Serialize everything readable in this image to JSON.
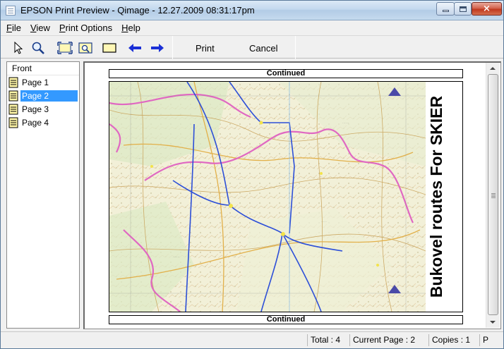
{
  "window": {
    "title": "EPSON Print Preview - Qimage - 12.27.2009 08:31:17pm",
    "minimize_label": "",
    "close_symbol": "×"
  },
  "menu": {
    "items": [
      {
        "label": "File",
        "accel": "F",
        "rest": "ile"
      },
      {
        "label": "View",
        "accel": "V",
        "rest": "iew"
      },
      {
        "label": "Print Options",
        "accel": "P",
        "rest": "rint Options"
      },
      {
        "label": "Help",
        "accel": "H",
        "rest": "elp"
      }
    ]
  },
  "toolbar": {
    "tools": [
      "pointer-icon",
      "zoom-icon",
      "fit-page-icon",
      "zoom-page-icon",
      "page-frame-icon",
      "arrow-left-icon",
      "arrow-right-icon"
    ],
    "print_label": "Print",
    "cancel_label": "Cancel",
    "arrow_color": "#1a2fd6"
  },
  "sidebar": {
    "header": "Front",
    "pages": [
      {
        "label": "Page 1",
        "selected": false
      },
      {
        "label": "Page 2",
        "selected": true
      },
      {
        "label": "Page 3",
        "selected": false
      },
      {
        "label": "Page 4",
        "selected": false
      }
    ],
    "selection_color": "#3399ff"
  },
  "preview": {
    "continued_top": "Continued",
    "continued_bottom": "Continued",
    "map_title": "Bukovel routes For SKIER"
  },
  "status": {
    "total": "Total : 4",
    "current_page": "Current Page : 2",
    "copies": "Copies : 1",
    "extra": "P"
  }
}
